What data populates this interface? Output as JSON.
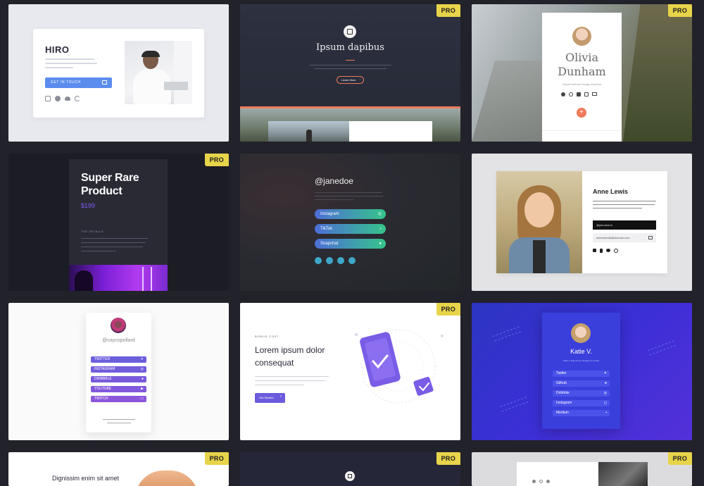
{
  "badge": "PRO",
  "cards": {
    "hiro": {
      "title": "HIRO",
      "button": "GET IN TOUCH"
    },
    "ipsum": {
      "title": "Ipsum dapibus",
      "button": "Learn More"
    },
    "olivia": {
      "name_line1": "Olivia",
      "name_line2": "Dunham",
      "subtitle": "Olivia Dunham Design Express"
    },
    "product": {
      "title_line1": "Super Rare",
      "title_line2": "Product",
      "price": "$199",
      "section": "THE DETAILS"
    },
    "janedoe": {
      "handle": "@janedoe",
      "links": [
        "Instagram",
        "TikTok",
        "Snapchat"
      ]
    },
    "anne": {
      "name": "Anne Lewis",
      "field1": "@johndoerrs",
      "field2": "adresdamail@domain.com"
    },
    "cayco": {
      "handle": "@caycopollard",
      "links": [
        "TWITTER",
        "INSTAGRAM",
        "DRIBBBLE",
        "YOUTUBE",
        "TWITCH"
      ]
    },
    "lorem": {
      "eyebrow": "BONUS COST",
      "title_line1": "Lorem ipsum dolor",
      "title_line2": "consequat",
      "button": "Get Started"
    },
    "katie": {
      "name": "Katie V.",
      "subtitle": "Katie V. Experience Designer & Coach",
      "links": [
        "Twitter",
        "Github",
        "Dribbble",
        "Instagram",
        "Medium"
      ]
    },
    "dignissim": {
      "title": "Dignissim enim sit amet"
    }
  },
  "colors": {
    "badge": "#e8d44a",
    "accent_blue": "#5b8def",
    "accent_orange": "#ef7b5a",
    "purple": "#6b5bdc",
    "katie_bg": "#3a2fd0"
  },
  "icons": [
    "instagram-icon",
    "globe-icon",
    "cloud-icon",
    "twitter-icon",
    "youtube-icon",
    "envelope-icon",
    "plus-icon",
    "check-icon",
    "book-logo-icon"
  ]
}
